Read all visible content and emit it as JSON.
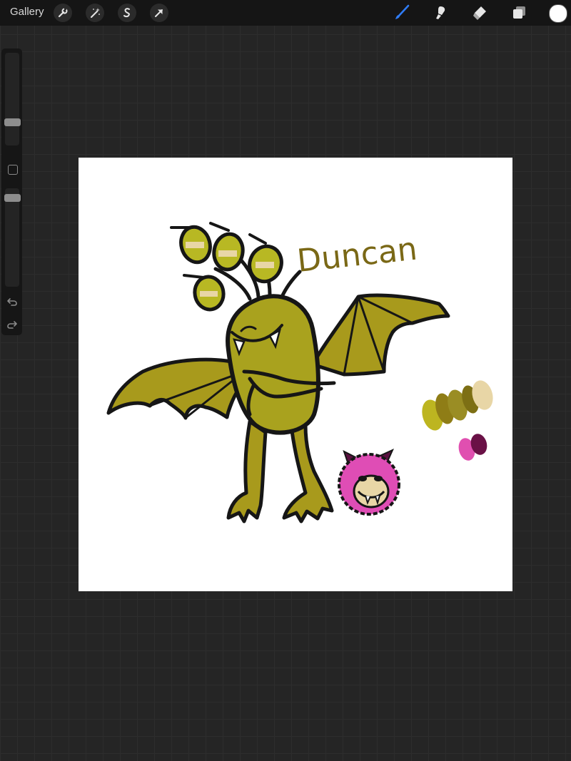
{
  "toolbar": {
    "gallery_label": "Gallery",
    "left_tools": [
      "wrench-icon",
      "magic-wand-icon",
      "selection-icon",
      "transform-arrow-icon"
    ],
    "right_tools": [
      "brush-icon",
      "smudge-icon",
      "eraser-icon",
      "layers-icon"
    ],
    "active_tool": "brush",
    "active_color": "#ffffff",
    "accent": "#2f7cf6"
  },
  "sidebar": {
    "brush_size_level": 0.75,
    "opacity_level": 0.05,
    "icons": [
      "modifier-square-icon",
      "undo-icon",
      "redo-icon"
    ]
  },
  "canvas": {
    "artwork_text": "Duncan",
    "palette": {
      "olive_swatches": [
        "#bdb520",
        "#8f7d16",
        "#9a8d24",
        "#7d6f14",
        "#e8d6a6"
      ],
      "pink_swatches": [
        "#e04fb0",
        "#6a1146"
      ]
    }
  }
}
